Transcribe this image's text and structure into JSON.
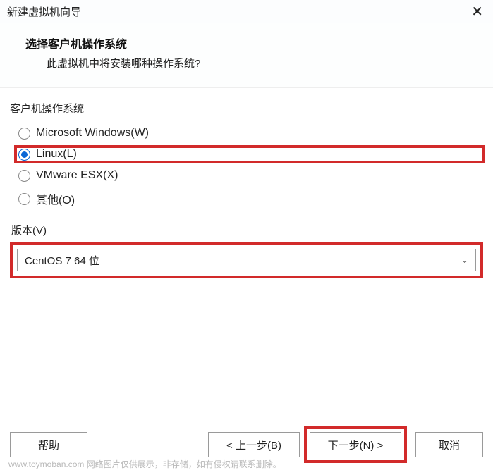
{
  "window": {
    "title": "新建虚拟机向导"
  },
  "header": {
    "title": "选择客户机操作系统",
    "subtitle": "此虚拟机中将安装哪种操作系统?"
  },
  "os_group": {
    "label": "客户机操作系统",
    "options": [
      {
        "label": "Microsoft Windows(W)",
        "selected": false
      },
      {
        "label": "Linux(L)",
        "selected": true
      },
      {
        "label": "VMware ESX(X)",
        "selected": false
      },
      {
        "label": "其他(O)",
        "selected": false
      }
    ]
  },
  "version": {
    "label": "版本(V)",
    "selected": "CentOS 7 64 位"
  },
  "buttons": {
    "help": "帮助",
    "back": "< 上一步(B)",
    "next": "下一步(N) >",
    "cancel": "取消"
  },
  "watermark": "www.toymoban.com 网络图片仅供展示，非存储，如有侵权请联系删除。",
  "highlight_color": "#d22a2a",
  "accent_color": "#0a66d6"
}
